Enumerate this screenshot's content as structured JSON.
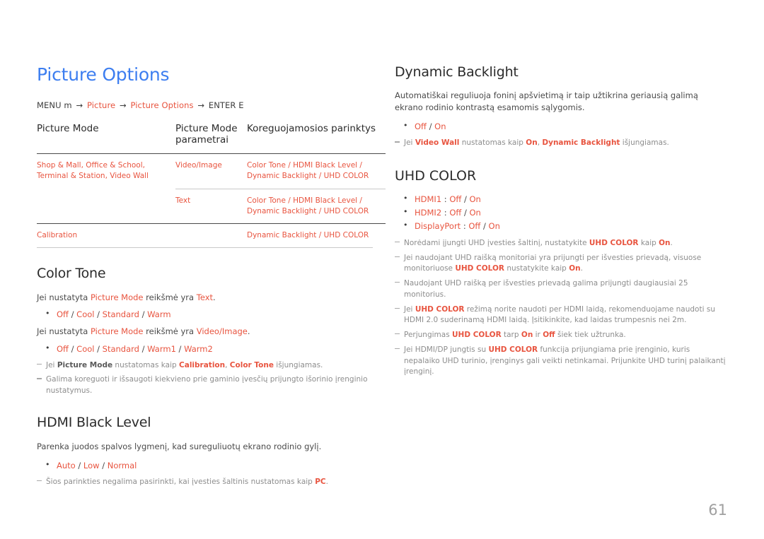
{
  "page": {
    "title": "Picture Options",
    "number": "61",
    "accent_blue": "#3d7ef0",
    "accent_orange": "#e8543f",
    "note_gray": "#8d8d8d"
  },
  "breadcrumb": {
    "menu": "MENU m",
    "arrow": "→",
    "item1": "Picture",
    "item2": "Picture Options",
    "enter": "ENTER E"
  },
  "table": {
    "headers": [
      "Picture Mode",
      "Picture Mode parametrai",
      "Koreguojamosios parinktys"
    ],
    "rows": [
      {
        "mode": "Shop & Mall, Office & School, Terminal & Station, Video Wall",
        "param": "Video/Image",
        "options": "Color Tone / HDMI Black Level / Dynamic Backlight / UHD COLOR"
      },
      {
        "mode": "",
        "param": "Text",
        "options": "Color Tone / HDMI Black Level / Dynamic Backlight / UHD COLOR"
      },
      {
        "mode": "Calibration",
        "param": "",
        "options": "Dynamic Backlight / UHD COLOR"
      }
    ]
  },
  "color_tone": {
    "heading": "Color Tone",
    "line1_pre": "Jei nustatyta ",
    "line1_hl1": "Picture Mode",
    "line1_mid": " reikšmė yra ",
    "line1_hl2": "Text",
    "line1_post": ".",
    "options1": [
      "Off",
      "Cool",
      "Standard",
      "Warm"
    ],
    "line2_pre": "Jei nustatyta ",
    "line2_hl1": "Picture Mode",
    "line2_mid": " reikšmė yra ",
    "line2_hl2": "Video/Image",
    "line2_post": ".",
    "options2": [
      "Off",
      "Cool",
      "Standard",
      "Warm1",
      "Warm2"
    ],
    "note1": {
      "p1": "Jei ",
      "b1": "Picture Mode",
      "p2": " nustatomas kaip ",
      "b2": "Calibration",
      "p3": ", ",
      "b3": "Color Tone",
      "p4": " išjungiamas."
    },
    "note2": "Galima koreguoti ir išsaugoti kiekvieno prie gaminio įvesčių prijungto išorinio įrenginio nustatymus."
  },
  "hdmi_black_level": {
    "heading": "HDMI Black Level",
    "description": "Parenka juodos spalvos lygmenį, kad sureguliuotų ekrano rodinio gylį.",
    "options": [
      "Auto",
      "Low",
      "Normal"
    ],
    "note": {
      "p1": "Šios parinkties negalima pasirinkti, kai įvesties šaltinis nustatomas kaip ",
      "b1": "PC",
      "p2": "."
    }
  },
  "dynamic_backlight": {
    "heading": "Dynamic Backlight",
    "description": "Automatiškai reguliuoja foninį apšvietimą ir taip užtikrina geriausią galimą ekrano rodinio kontrastą esamomis sąlygomis.",
    "options": [
      "Off",
      "On"
    ],
    "note": {
      "p1": "Jei ",
      "b1": "Video Wall",
      "p2": " nustatomas kaip ",
      "b2": "On",
      "p3": ", ",
      "b3": "Dynamic Backlight",
      "p4": " išjungiamas."
    }
  },
  "uhd_color": {
    "heading": "UHD COLOR",
    "bullets": [
      {
        "label": "HDMI1",
        "sep": " : ",
        "opt1": "Off",
        "slash": " / ",
        "opt2": "On"
      },
      {
        "label": "HDMI2",
        "sep": " : ",
        "opt1": "Off",
        "slash": " / ",
        "opt2": "On"
      },
      {
        "label": "DisplayPort",
        "sep": " : ",
        "opt1": "Off",
        "slash": " / ",
        "opt2": "On"
      }
    ],
    "notes": [
      {
        "p1": "Norėdami įjungti UHD įvesties šaltinį, nustatykite ",
        "b1": "UHD COLOR",
        "p2": " kaip ",
        "b2": "On",
        "p3": "."
      },
      {
        "p1": "Jei naudojant UHD raišką monitoriai yra prijungti per išvesties prievadą, visuose monitoriuose ",
        "b1": "UHD COLOR",
        "p2": " nustatykite kaip ",
        "b2": "On",
        "p3": "."
      },
      {
        "p1": "Naudojant UHD raišką per išvesties prievadą galima prijungti daugiausiai 25 monitorius.",
        "b1": "",
        "p2": "",
        "b2": "",
        "p3": ""
      },
      {
        "p1": "Jei ",
        "b1": "UHD COLOR",
        "p2": " režimą norite naudoti per HDMI laidą, rekomenduojame naudoti su HDMI 2.0 suderinamą HDMI laidą. Įsitikinkite, kad laidas trumpesnis nei 2m.",
        "b2": "",
        "p3": ""
      },
      {
        "p1": "Perjungimas ",
        "b1": "UHD COLOR",
        "p2": " tarp ",
        "b2": "On",
        "p3": " ir ",
        "b3": "Off",
        "p4": " šiek tiek užtrunka."
      },
      {
        "p1": "Jei HDMI/DP jungtis su ",
        "b1": "UHD COLOR",
        "p2": " funkcija prijungiama prie įrenginio, kuris nepalaiko UHD turinio, įrenginys gali veikti netinkamai. Prijunkite UHD turinį palaikantį įrenginį.",
        "b2": "",
        "p3": ""
      }
    ]
  }
}
